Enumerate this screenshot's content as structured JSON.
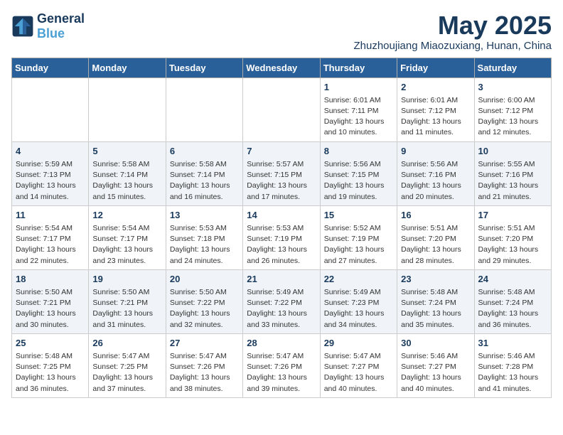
{
  "logo": {
    "line1": "General",
    "line2": "Blue"
  },
  "title": {
    "month_year": "May 2025",
    "location": "Zhuzhoujiang Miaozuxiang, Hunan, China"
  },
  "weekdays": [
    "Sunday",
    "Monday",
    "Tuesday",
    "Wednesday",
    "Thursday",
    "Friday",
    "Saturday"
  ],
  "weeks": [
    [
      {
        "day": "",
        "info": ""
      },
      {
        "day": "",
        "info": ""
      },
      {
        "day": "",
        "info": ""
      },
      {
        "day": "",
        "info": ""
      },
      {
        "day": "1",
        "info": "Sunrise: 6:01 AM\nSunset: 7:11 PM\nDaylight: 13 hours\nand 10 minutes."
      },
      {
        "day": "2",
        "info": "Sunrise: 6:01 AM\nSunset: 7:12 PM\nDaylight: 13 hours\nand 11 minutes."
      },
      {
        "day": "3",
        "info": "Sunrise: 6:00 AM\nSunset: 7:12 PM\nDaylight: 13 hours\nand 12 minutes."
      }
    ],
    [
      {
        "day": "4",
        "info": "Sunrise: 5:59 AM\nSunset: 7:13 PM\nDaylight: 13 hours\nand 14 minutes."
      },
      {
        "day": "5",
        "info": "Sunrise: 5:58 AM\nSunset: 7:14 PM\nDaylight: 13 hours\nand 15 minutes."
      },
      {
        "day": "6",
        "info": "Sunrise: 5:58 AM\nSunset: 7:14 PM\nDaylight: 13 hours\nand 16 minutes."
      },
      {
        "day": "7",
        "info": "Sunrise: 5:57 AM\nSunset: 7:15 PM\nDaylight: 13 hours\nand 17 minutes."
      },
      {
        "day": "8",
        "info": "Sunrise: 5:56 AM\nSunset: 7:15 PM\nDaylight: 13 hours\nand 19 minutes."
      },
      {
        "day": "9",
        "info": "Sunrise: 5:56 AM\nSunset: 7:16 PM\nDaylight: 13 hours\nand 20 minutes."
      },
      {
        "day": "10",
        "info": "Sunrise: 5:55 AM\nSunset: 7:16 PM\nDaylight: 13 hours\nand 21 minutes."
      }
    ],
    [
      {
        "day": "11",
        "info": "Sunrise: 5:54 AM\nSunset: 7:17 PM\nDaylight: 13 hours\nand 22 minutes."
      },
      {
        "day": "12",
        "info": "Sunrise: 5:54 AM\nSunset: 7:17 PM\nDaylight: 13 hours\nand 23 minutes."
      },
      {
        "day": "13",
        "info": "Sunrise: 5:53 AM\nSunset: 7:18 PM\nDaylight: 13 hours\nand 24 minutes."
      },
      {
        "day": "14",
        "info": "Sunrise: 5:53 AM\nSunset: 7:19 PM\nDaylight: 13 hours\nand 26 minutes."
      },
      {
        "day": "15",
        "info": "Sunrise: 5:52 AM\nSunset: 7:19 PM\nDaylight: 13 hours\nand 27 minutes."
      },
      {
        "day": "16",
        "info": "Sunrise: 5:51 AM\nSunset: 7:20 PM\nDaylight: 13 hours\nand 28 minutes."
      },
      {
        "day": "17",
        "info": "Sunrise: 5:51 AM\nSunset: 7:20 PM\nDaylight: 13 hours\nand 29 minutes."
      }
    ],
    [
      {
        "day": "18",
        "info": "Sunrise: 5:50 AM\nSunset: 7:21 PM\nDaylight: 13 hours\nand 30 minutes."
      },
      {
        "day": "19",
        "info": "Sunrise: 5:50 AM\nSunset: 7:21 PM\nDaylight: 13 hours\nand 31 minutes."
      },
      {
        "day": "20",
        "info": "Sunrise: 5:50 AM\nSunset: 7:22 PM\nDaylight: 13 hours\nand 32 minutes."
      },
      {
        "day": "21",
        "info": "Sunrise: 5:49 AM\nSunset: 7:22 PM\nDaylight: 13 hours\nand 33 minutes."
      },
      {
        "day": "22",
        "info": "Sunrise: 5:49 AM\nSunset: 7:23 PM\nDaylight: 13 hours\nand 34 minutes."
      },
      {
        "day": "23",
        "info": "Sunrise: 5:48 AM\nSunset: 7:24 PM\nDaylight: 13 hours\nand 35 minutes."
      },
      {
        "day": "24",
        "info": "Sunrise: 5:48 AM\nSunset: 7:24 PM\nDaylight: 13 hours\nand 36 minutes."
      }
    ],
    [
      {
        "day": "25",
        "info": "Sunrise: 5:48 AM\nSunset: 7:25 PM\nDaylight: 13 hours\nand 36 minutes."
      },
      {
        "day": "26",
        "info": "Sunrise: 5:47 AM\nSunset: 7:25 PM\nDaylight: 13 hours\nand 37 minutes."
      },
      {
        "day": "27",
        "info": "Sunrise: 5:47 AM\nSunset: 7:26 PM\nDaylight: 13 hours\nand 38 minutes."
      },
      {
        "day": "28",
        "info": "Sunrise: 5:47 AM\nSunset: 7:26 PM\nDaylight: 13 hours\nand 39 minutes."
      },
      {
        "day": "29",
        "info": "Sunrise: 5:47 AM\nSunset: 7:27 PM\nDaylight: 13 hours\nand 40 minutes."
      },
      {
        "day": "30",
        "info": "Sunrise: 5:46 AM\nSunset: 7:27 PM\nDaylight: 13 hours\nand 40 minutes."
      },
      {
        "day": "31",
        "info": "Sunrise: 5:46 AM\nSunset: 7:28 PM\nDaylight: 13 hours\nand 41 minutes."
      }
    ]
  ]
}
